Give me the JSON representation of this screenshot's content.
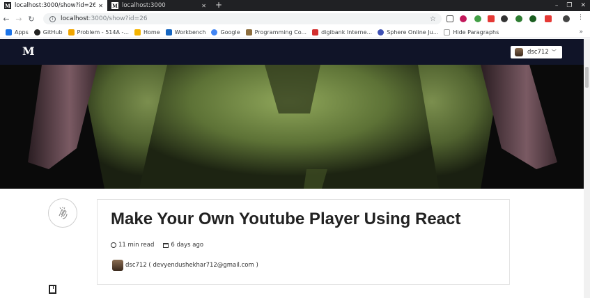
{
  "browser": {
    "tabs": [
      {
        "label": "localhost:3000/show?id=26",
        "favicon": "M",
        "active": true
      },
      {
        "label": "localhost:3000",
        "favicon": "M",
        "active": false
      }
    ],
    "url_host": "localhost",
    "url_path": ":3000/show?id=26",
    "bookmarks": [
      {
        "label": "Apps",
        "icon": "apps-grid-icon",
        "color": "#1a73e8"
      },
      {
        "label": "GitHub",
        "icon": "github-icon",
        "color": "#222222"
      },
      {
        "label": "Problem - 514A -...",
        "icon": "codeforces-icon",
        "color": "#f0a500"
      },
      {
        "label": "Home",
        "icon": "home-icon",
        "color": "#f5b400"
      },
      {
        "label": "Workbench",
        "icon": "workbench-icon",
        "color": "#1565c0"
      },
      {
        "label": "Google",
        "icon": "google-icon",
        "color": "#4285f4"
      },
      {
        "label": "Programming Co...",
        "icon": "programming-icon",
        "color": "#8d6e3f"
      },
      {
        "label": "digibank Interne...",
        "icon": "digibank-icon",
        "color": "#d32f2f"
      },
      {
        "label": "Sphere Online Ju...",
        "icon": "spoj-icon",
        "color": "#3f51b5"
      },
      {
        "label": "Hide Paragraphs",
        "icon": "page-icon",
        "color": "#9e9e9e"
      }
    ],
    "more": "»"
  },
  "site": {
    "logo": "M",
    "user": "dsc712"
  },
  "post": {
    "title": "Make Your Own Youtube Player Using React",
    "read_time": "11 min read",
    "posted": "6 days ago",
    "author": "dsc712 ( devyendushekhar712@gmail.com )"
  }
}
